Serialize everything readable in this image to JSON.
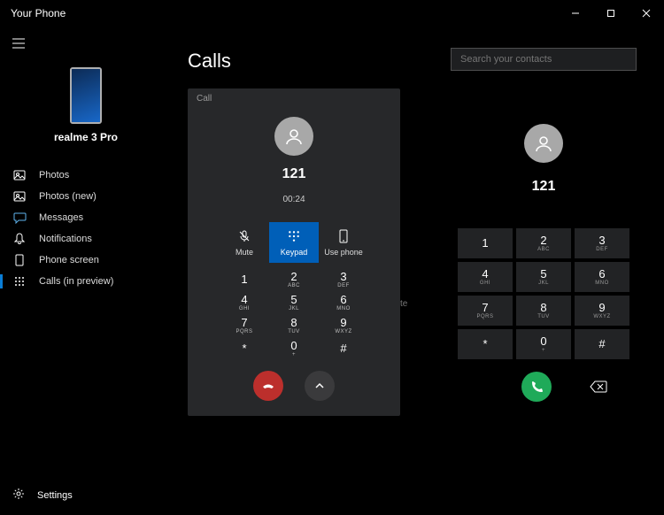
{
  "window": {
    "title": "Your Phone"
  },
  "sidebar": {
    "phone_name": "realme 3 Pro",
    "items": [
      {
        "label": "Photos"
      },
      {
        "label": "Photos (new)"
      },
      {
        "label": "Messages"
      },
      {
        "label": "Notifications"
      },
      {
        "label": "Phone screen"
      },
      {
        "label": "Calls (in preview)"
      }
    ],
    "settings_label": "Settings"
  },
  "main": {
    "page_title": "Calls",
    "call_card": {
      "label": "Call",
      "number": "121",
      "duration": "00:24",
      "actions": {
        "mute": "Mute",
        "keypad": "Keypad",
        "use_phone": "Use phone"
      }
    },
    "stray_text": "te",
    "keypad": [
      {
        "d": "1",
        "l": ""
      },
      {
        "d": "2",
        "l": "ABC"
      },
      {
        "d": "3",
        "l": "DEF"
      },
      {
        "d": "4",
        "l": "GHI"
      },
      {
        "d": "5",
        "l": "JKL"
      },
      {
        "d": "6",
        "l": "MNO"
      },
      {
        "d": "7",
        "l": "PQRS"
      },
      {
        "d": "8",
        "l": "TUV"
      },
      {
        "d": "9",
        "l": "WXYZ"
      },
      {
        "d": "*",
        "l": ""
      },
      {
        "d": "0",
        "l": "+"
      },
      {
        "d": "#",
        "l": ""
      }
    ]
  },
  "dialer": {
    "search_placeholder": "Search your contacts",
    "number": "121",
    "keypad": [
      {
        "d": "1",
        "l": ""
      },
      {
        "d": "2",
        "l": "ABC"
      },
      {
        "d": "3",
        "l": "DEF"
      },
      {
        "d": "4",
        "l": "GHI"
      },
      {
        "d": "5",
        "l": "JKL"
      },
      {
        "d": "6",
        "l": "MNO"
      },
      {
        "d": "7",
        "l": "PQRS"
      },
      {
        "d": "8",
        "l": "TUV"
      },
      {
        "d": "9",
        "l": "WXYZ"
      },
      {
        "d": "*",
        "l": ""
      },
      {
        "d": "0",
        "l": "+"
      },
      {
        "d": "#",
        "l": ""
      }
    ]
  }
}
